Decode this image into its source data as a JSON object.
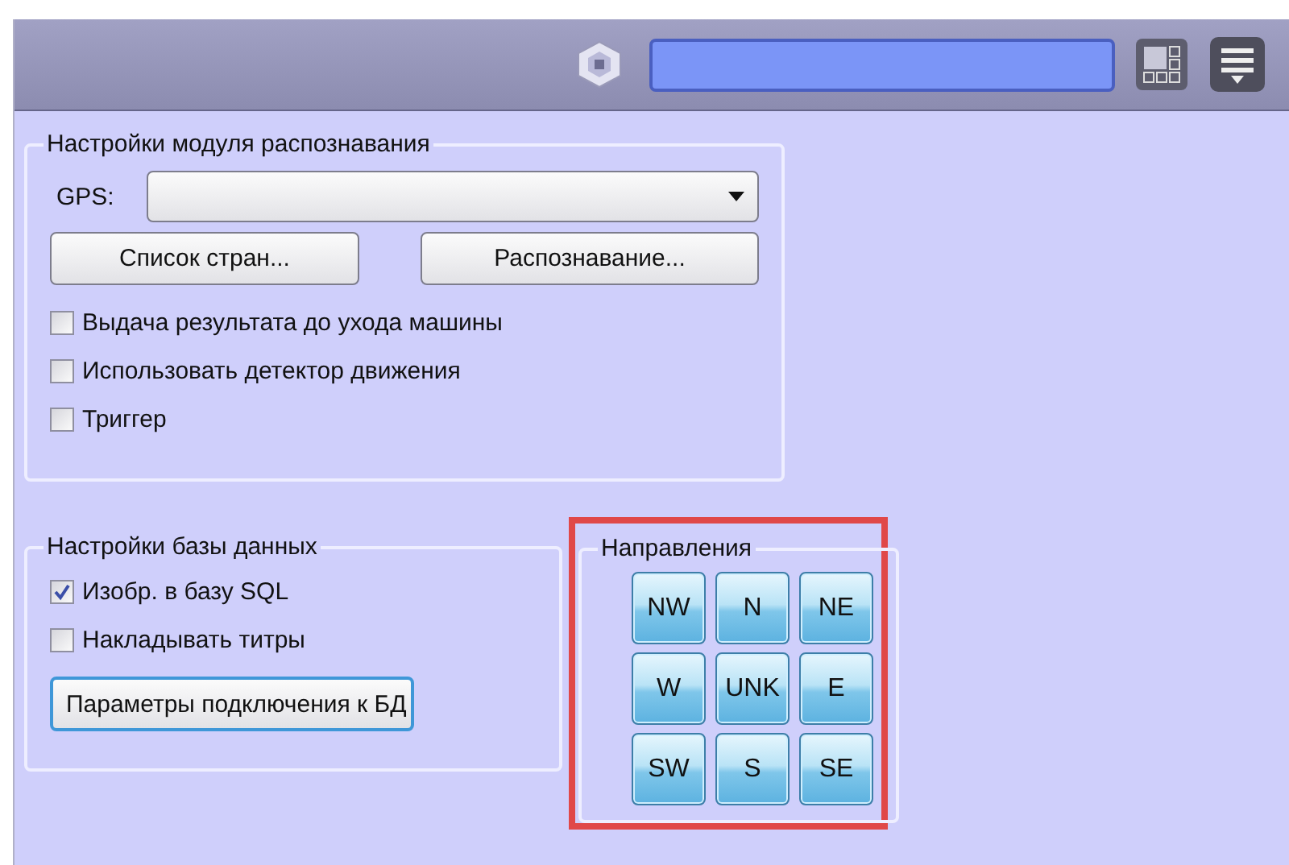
{
  "recognition_settings": {
    "title": "Настройки модуля распознавания",
    "gps": {
      "label": "GPS:"
    },
    "buttons": [
      "Список стран...",
      "Распознавание..."
    ],
    "options": [
      {
        "label": "Выдача результата до ухода машины",
        "checked": false
      },
      {
        "label": "Использовать детектор движения",
        "checked": false
      },
      {
        "label": "Триггер",
        "checked": false
      }
    ]
  },
  "database_settings": {
    "title": "Настройки базы данных",
    "options": [
      {
        "label": "Изобр. в базу SQL",
        "checked": true
      },
      {
        "label": "Накладывать титры",
        "checked": false
      }
    ],
    "button": {
      "label": "Параметры подключения к БД",
      "focused": true
    }
  },
  "directions": {
    "title": "Направления",
    "highlighted": true,
    "buttons": [
      "NW",
      "N",
      "NE",
      "W",
      "UNK",
      "E",
      "SW",
      "S",
      "SE"
    ]
  }
}
